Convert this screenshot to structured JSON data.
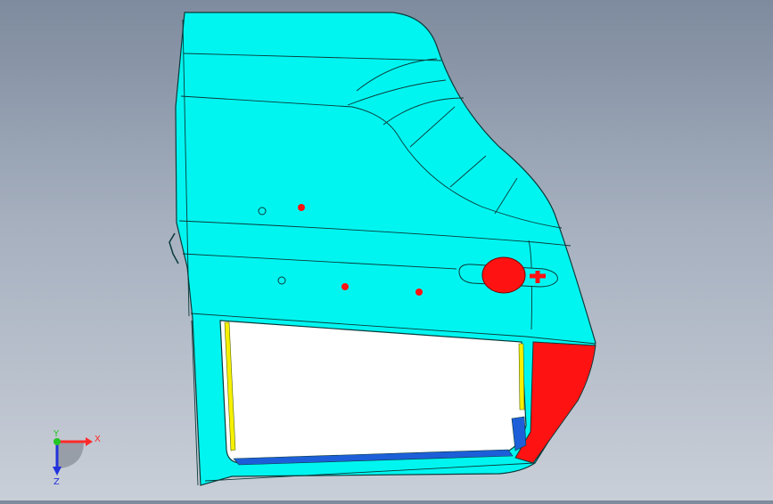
{
  "triad": {
    "x_label": "X",
    "y_label": "Y",
    "z_label": "Z",
    "x_color": "#ff2a2a",
    "y_color": "#22c522",
    "z_color": "#2233dd"
  },
  "model": {
    "body_color": "#00f5f0",
    "accent_color": "#ff1212",
    "edge_color": "#0a3a3a",
    "seal_color": "#f6f000",
    "trim_color": "#1d5fd8"
  }
}
